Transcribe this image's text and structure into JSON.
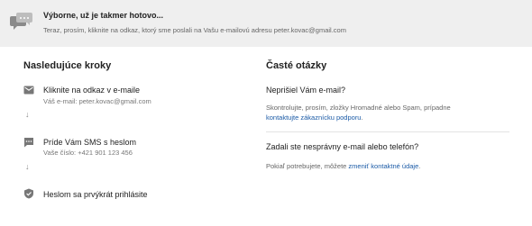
{
  "banner": {
    "title": "Výborne, už je takmer hotovo...",
    "text": "Teraz, prosím, kliknite na odkaz, ktorý sme poslali na Vašu e-mailovú adresu peter.kovac@gmail.com"
  },
  "steps": {
    "heading": "Nasledujúce kroky",
    "items": [
      {
        "icon": "email-icon",
        "title": "Kliknite na odkaz v e-maile",
        "sub": "Váš e-mail: peter.kovac@gmail.com"
      },
      {
        "icon": "sms-icon",
        "title": "Príde Vám SMS s heslom",
        "sub": "Vaše číslo: +421 901 123 456"
      },
      {
        "icon": "shield-check-icon",
        "title": "Heslom sa prvýkrát prihlásite",
        "sub": ""
      }
    ]
  },
  "faq": {
    "heading": "Časté otázky",
    "items": [
      {
        "question": "Neprišiel Vám e-mail?",
        "text_line1": "Skontrolujte, prosím, zložky Hromadné alebo Spam, prípadne",
        "link": "kontaktujte zákaznícku podporu",
        "text_after": "."
      },
      {
        "question": "Zadali ste nesprávny e-mail alebo telefón?",
        "text_before": "Pokiaľ potrebujete, môžete ",
        "link": "zmeniť kontaktné údaje",
        "text_after": "."
      }
    ]
  },
  "colors": {
    "banner_bg": "#efefef",
    "link": "#1a5aa6",
    "icon": "#777777"
  }
}
